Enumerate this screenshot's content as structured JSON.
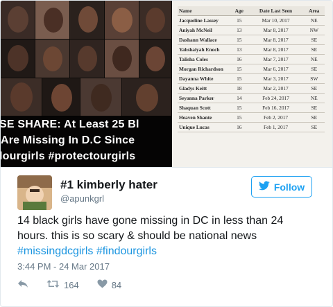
{
  "media": {
    "banner_lines": [
      "SE SHARE: At Least 25 Bl",
      " Are Missing In D.C Since",
      "lourgirls #protectourgirls"
    ],
    "table": {
      "headers": [
        "Name",
        "Age",
        "Date Last Seen",
        "Area"
      ],
      "rows": [
        {
          "name": "Jacqueline Lassey",
          "age": "15",
          "date": "Mar 10, 2017",
          "area": "NE"
        },
        {
          "name": "Aniyah McNeil",
          "age": "13",
          "date": "Mar 8, 2017",
          "area": "NW"
        },
        {
          "name": "Dashann Wallace",
          "age": "15",
          "date": "Mar 8, 2017",
          "area": "SE"
        },
        {
          "name": "Yahshaiyah Enoch",
          "age": "13",
          "date": "Mar 8, 2017",
          "area": "SE"
        },
        {
          "name": "Talisha Coles",
          "age": "16",
          "date": "Mar 7, 2017",
          "area": "NE"
        },
        {
          "name": "Morgan Richardson",
          "age": "15",
          "date": "Mar 6, 2017",
          "area": "SE"
        },
        {
          "name": "Dayanna White",
          "age": "15",
          "date": "Mar 3, 2017",
          "area": "SW"
        },
        {
          "name": "Gladys Keitt",
          "age": "18",
          "date": "Mar 2, 2017",
          "area": "SE"
        },
        {
          "name": "Seyanna Parker",
          "age": "14",
          "date": "Feb 24, 2017",
          "area": "NE"
        },
        {
          "name": "Shaquan Scott",
          "age": "15",
          "date": "Feb 16, 2017",
          "area": "SE"
        },
        {
          "name": "Heaven Shante",
          "age": "15",
          "date": "Feb 2, 2017",
          "area": "SE"
        },
        {
          "name": "Unique Lucas",
          "age": "16",
          "date": "Feb 1, 2017",
          "area": "SE"
        }
      ]
    }
  },
  "tweet": {
    "display_name": "#1 kimberly hater",
    "handle": "@apunkgrl",
    "follow_label": "Follow",
    "follow_icon": "twitter-bird-icon",
    "text": "14 black girls have gone missing in DC in less than 24 hours. this is so scary & should be national news",
    "hashtags": "#missingdcgirls #findourgirls",
    "timestamp": "3:44 PM - 24 Mar 2017",
    "retweets": "164",
    "likes": "84"
  },
  "colors": {
    "accent": "#1da1f2",
    "hashtag": "#1b95e0",
    "secondary_text": "#657786",
    "primary_text": "#14171a",
    "border": "#e1e8ed"
  }
}
